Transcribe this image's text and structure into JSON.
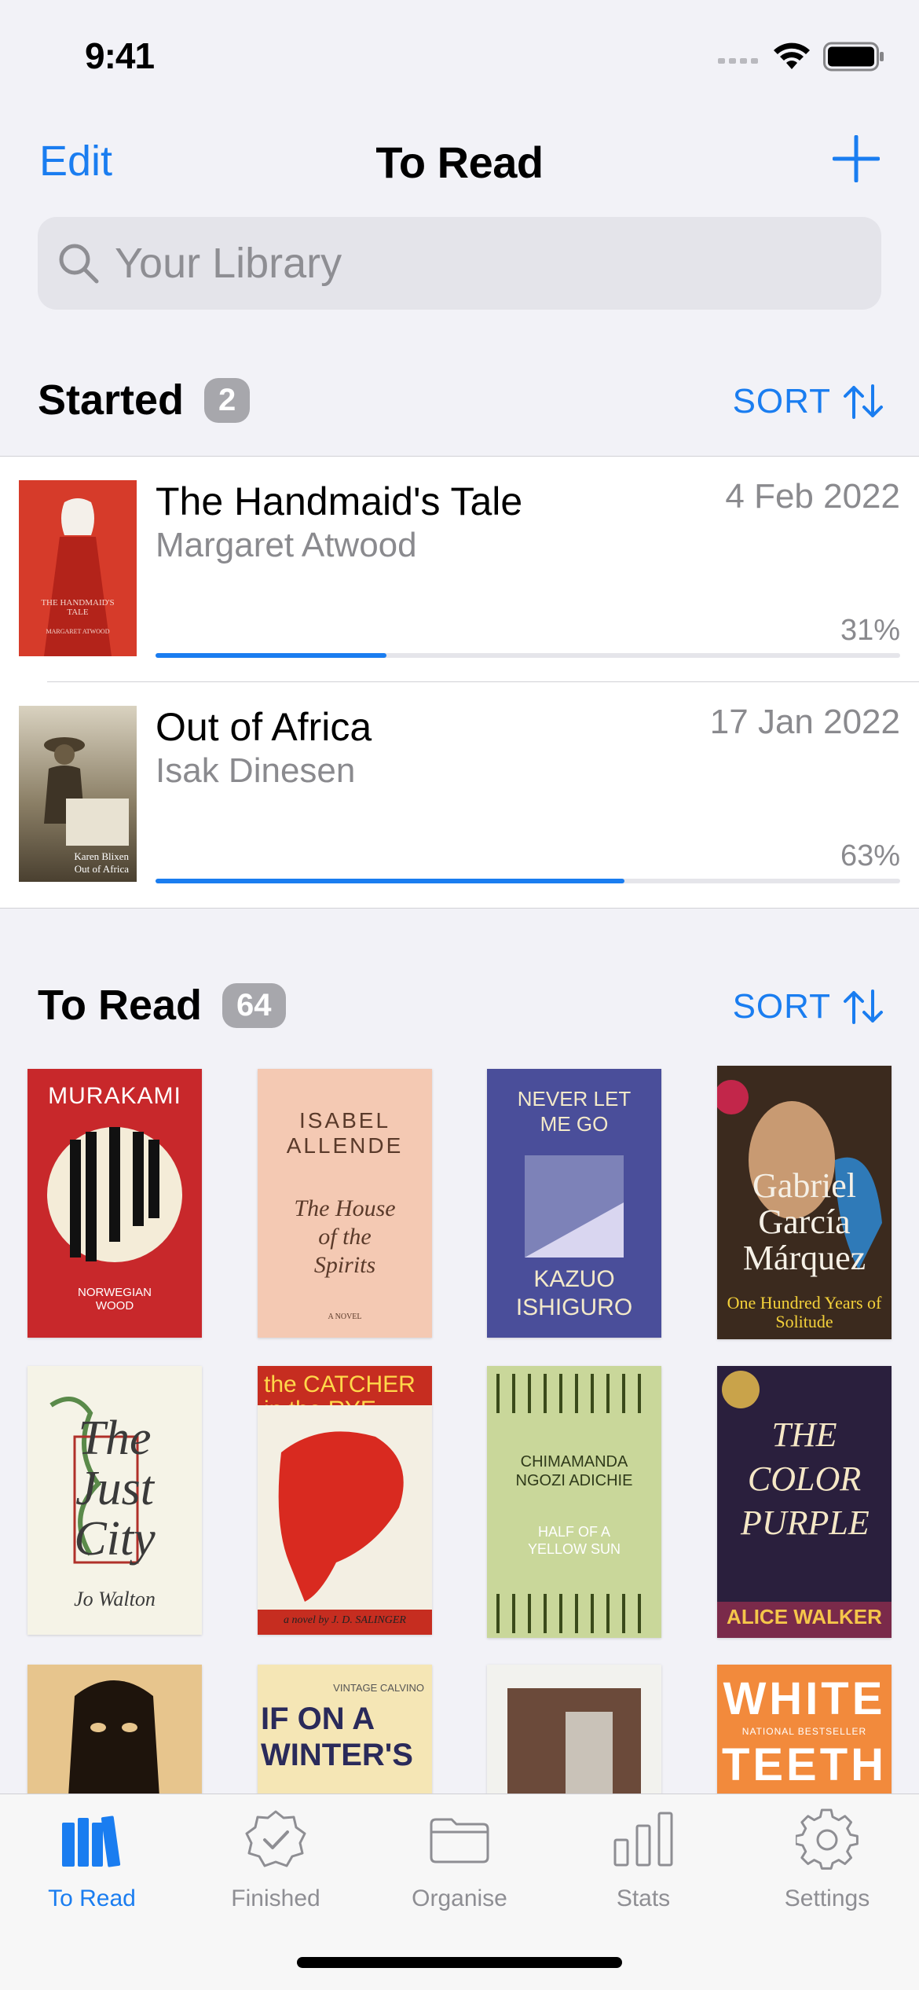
{
  "status": {
    "time": "9:41"
  },
  "nav": {
    "edit_label": "Edit",
    "title": "To Read"
  },
  "search": {
    "placeholder": "Your Library"
  },
  "started": {
    "title": "Started",
    "count": "2",
    "sort_label": "SORT",
    "books": [
      {
        "title": "The Handmaid's Tale",
        "author": "Margaret Atwood",
        "date": "4 Feb 2022",
        "progress_label": "31%",
        "progress": 0.31,
        "cover": {
          "bg": "#d63b2a",
          "text": "THE HANDMAID'S TALE",
          "subtext": "MARGARET ATWOOD"
        }
      },
      {
        "title": "Out of Africa",
        "author": "Isak Dinesen",
        "date": "17 Jan 2022",
        "progress_label": "63%",
        "progress": 0.63,
        "cover": {
          "bg": "#6f6652",
          "text": "Karen Blixen",
          "subtext": "Out of Africa"
        }
      }
    ]
  },
  "to_read": {
    "title": "To Read",
    "count": "64",
    "sort_label": "SORT",
    "covers": [
      {
        "bg": "#c8282b",
        "fg": "#ffffff",
        "top": "MURAKAMI",
        "main": "",
        "bottom": "NORWEGIAN WOOD"
      },
      {
        "bg": "#f4c9b3",
        "fg": "#5a3a2a",
        "top": "ISABEL ALLENDE",
        "main": "The House of the Spirits",
        "bottom": "A NOVEL"
      },
      {
        "bg": "#4a4e9a",
        "fg": "#f3e9c9",
        "top": "NEVER LET ME GO",
        "main": "",
        "bottom": "KAZUO ISHIGURO"
      },
      {
        "bg": "#3b2a1e",
        "fg": "#f5d23a",
        "top": "",
        "main": "Gabriel García Márquez",
        "bottom": "One Hundred Years of Solitude"
      },
      {
        "bg": "#f5f3e7",
        "fg": "#3a3a3a",
        "top": "",
        "main": "The Just City",
        "bottom": "Jo Walton"
      },
      {
        "bg": "#c62d20",
        "fg": "#ffd84a",
        "top": "the CATCHER in the RYE",
        "main": "",
        "bottom": "a novel by J. D. SALINGER"
      },
      {
        "bg": "#c9d79a",
        "fg": "#2f3a1a",
        "top": "CHIMAMANDA NGOZI ADICHIE",
        "main": "HALF OF A YELLOW SUN",
        "bottom": ""
      },
      {
        "bg": "#2a1f3d",
        "fg": "#f5e7c6",
        "top": "",
        "main": "THE COLOR PURPLE",
        "bottom": "ALICE WALKER"
      },
      {
        "bg": "#e7c58d",
        "fg": "#2a1a0a",
        "top": "",
        "main": "",
        "bottom": ""
      },
      {
        "bg": "#f5e6b5",
        "fg": "#2a2a5a",
        "top": "VINTAGE CALVINO",
        "main": "IF ON A WINTER'S",
        "bottom": ""
      },
      {
        "bg": "#f2f2ee",
        "fg": "#4a2a2a",
        "top": "",
        "main": "",
        "bottom": ""
      },
      {
        "bg": "#f28a3c",
        "fg": "#ffffff",
        "top": "WHITE",
        "main": "NATIONAL BESTSELLER",
        "bottom": "TEETH"
      }
    ]
  },
  "tabs": [
    {
      "label": "To Read",
      "icon": "books-icon",
      "active": true
    },
    {
      "label": "Finished",
      "icon": "checkmark-seal-icon",
      "active": false
    },
    {
      "label": "Organise",
      "icon": "folder-icon",
      "active": false
    },
    {
      "label": "Stats",
      "icon": "chart-bar-icon",
      "active": false
    },
    {
      "label": "Settings",
      "icon": "gear-icon",
      "active": false
    }
  ],
  "colors": {
    "accent": "#1a7df0",
    "background": "#f2f2f7",
    "secondary_text": "#8a8a8e"
  }
}
